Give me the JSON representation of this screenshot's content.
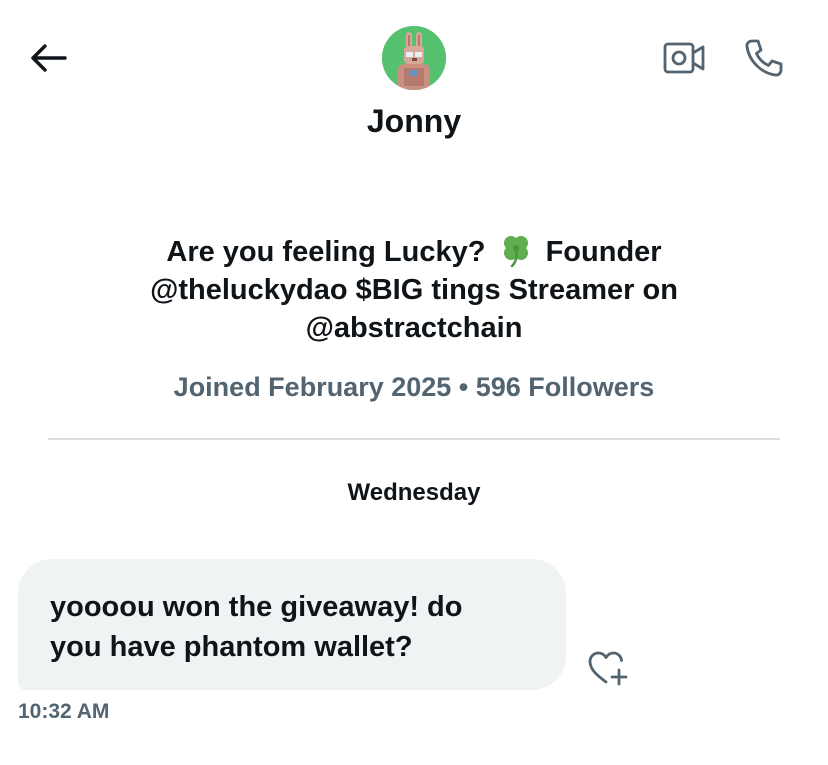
{
  "header": {
    "back_icon": "arrow-left-icon",
    "video_icon": "video-camera-icon",
    "call_icon": "phone-icon",
    "name": "Jonny"
  },
  "profile": {
    "bio_line1_prefix": "Are you feeling Lucky?",
    "bio_emoji": "four-leaf-clover",
    "bio_line1_suffix": "Founder",
    "bio_line2": "@theluckydao $BIG tings Streamer on",
    "bio_line3": "@abstractchain",
    "meta": "Joined February 2025 • 596 Followers"
  },
  "conversation": {
    "day_label": "Wednesday",
    "messages": [
      {
        "text_line1": "yoooou won the giveaway! do",
        "text_line2": "you have phantom wallet?",
        "time": "10:32 AM"
      }
    ],
    "react_icon": "heart-plus-icon"
  },
  "colors": {
    "text": "#0f1419",
    "muted": "#536471",
    "bubble": "#eff3f4",
    "divider": "#d8dde1",
    "avatar_bg": "#56c26f"
  }
}
